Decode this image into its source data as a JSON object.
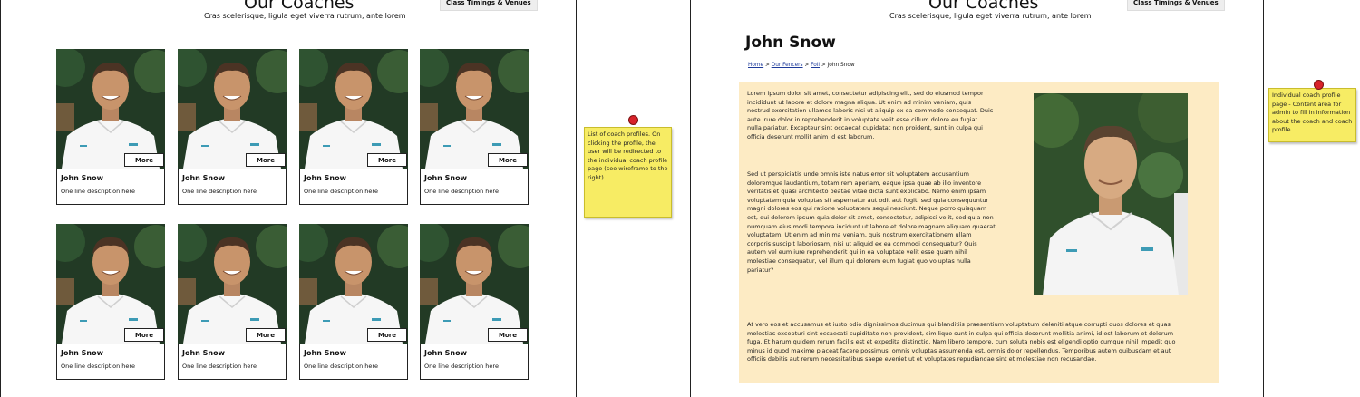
{
  "left": {
    "title": "Our Coaches",
    "subtitle": "Cras scelerisque, ligula eget viverra rutrum, ante lorem",
    "tab_label": "Class Timings & Venues",
    "cards": [
      {
        "name": "John Snow",
        "desc": "One line description here",
        "more": "More"
      },
      {
        "name": "John Snow",
        "desc": "One line description here",
        "more": "More"
      },
      {
        "name": "John Snow",
        "desc": "One line description here",
        "more": "More"
      },
      {
        "name": "John Snow",
        "desc": "One line description here",
        "more": "More"
      },
      {
        "name": "John Snow",
        "desc": "One line description here",
        "more": "More"
      },
      {
        "name": "John Snow",
        "desc": "One line description here",
        "more": "More"
      },
      {
        "name": "John Snow",
        "desc": "One line description here",
        "more": "More"
      },
      {
        "name": "John Snow",
        "desc": "One line description here",
        "more": "More"
      }
    ]
  },
  "note_left": "List of coach profiles. On clicking the profile, the user will be redirected to the individual coach profile page (see wireframe to the right)",
  "right": {
    "title": "Our Coaches",
    "subtitle": "Cras scelerisque, ligula eget viverra rutrum, ante lorem",
    "tab_label": "Class Timings & Venues",
    "profile_name": "John Snow",
    "breadcrumb": {
      "home": "Home",
      "fencers": "Our Fencers",
      "foil": "Foil",
      "sep": ">",
      "current": "John Snow"
    },
    "para1": "Lorem ipsum dolor sit amet, consectetur adipiscing elit, sed do eiusmod tempor incididunt ut labore et dolore magna aliqua. Ut enim ad minim veniam, quis nostrud exercitation ullamco laboris nisi ut aliquip ex ea commodo consequat. Duis aute irure dolor in reprehenderit in voluptate velit esse cillum dolore eu fugiat nulla pariatur. Excepteur sint occaecat cupidatat non proident, sunt in culpa qui officia deserunt mollit anim id est laborum.",
    "para2": "Sed ut perspiciatis unde omnis iste natus error sit voluptatem accusantium doloremque laudantium, totam rem aperiam, eaque ipsa quae ab illo inventore veritatis et quasi architecto beatae vitae dicta sunt explicabo. Nemo enim ipsam voluptatem quia voluptas sit aspernatur aut odit aut fugit, sed quia consequuntur magni dolores eos qui ratione voluptatem sequi nesciunt. Neque porro quisquam est, qui dolorem ipsum quia dolor sit amet, consectetur, adipisci velit, sed quia non numquam eius modi tempora incidunt ut labore et dolore magnam aliquam quaerat voluptatem. Ut enim ad minima veniam, quis nostrum exercitationem ullam corporis suscipit laboriosam, nisi ut aliquid ex ea commodi consequatur? Quis autem vel eum iure reprehenderit qui in ea voluptate velit esse quam nihil molestiae consequatur, vel illum qui dolorem eum fugiat quo voluptas nulla pariatur?",
    "para3": "At vero eos et accusamus et iusto odio dignissimos ducimus qui blanditiis praesentium voluptatum deleniti atque corrupti quos dolores et quas molestias excepturi sint occaecati cupiditate non provident, similique sunt in culpa qui officia deserunt mollitia animi, id est laborum et dolorum fuga. Et harum quidem rerum facilis est et expedita distinctio. Nam libero tempore, cum soluta nobis est eligendi optio cumque nihil impedit quo minus id quod maxime placeat facere possimus, omnis voluptas assumenda est, omnis dolor repellendus. Temporibus autem quibusdam et aut officiis debitis aut rerum necessitatibus saepe eveniet ut et voluptates repudiandae sint et molestiae non recusandae."
  },
  "note_right": "Individual coach profile page - Content area for admin to fill in information about the coach and coach profile",
  "colors": {
    "sticky": "#f7ec64",
    "content_bg": "#fdebc4",
    "link": "#1d3a9a",
    "pin": "#d8222a"
  }
}
